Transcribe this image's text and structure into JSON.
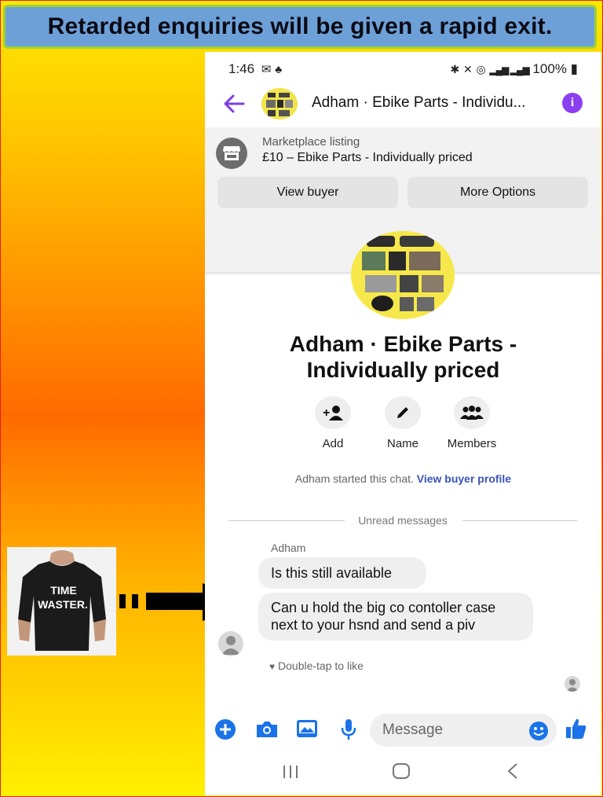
{
  "banner": {
    "text": "Retarded enquiries will be given a rapid exit."
  },
  "status": {
    "time": "1:46",
    "battery": "100%",
    "left_icons": "gmail-icon, notification-icon",
    "right_icons": "bluetooth, mute, hotspot, 4G signal, signal"
  },
  "header": {
    "title": "Adham · Ebike Parts  - Individu...",
    "info_label": "i"
  },
  "listing": {
    "label": "Marketplace listing",
    "item": "£10 – Ebike Parts  - Individually priced",
    "view_buyer": "View buyer",
    "more_options": "More Options"
  },
  "profile": {
    "name_line1": "Adham · Ebike Parts  -",
    "name_line2": "Individually priced",
    "actions": [
      {
        "label": "Add",
        "icon": "add-person-icon"
      },
      {
        "label": "Name",
        "icon": "pencil-icon"
      },
      {
        "label": "Members",
        "icon": "members-icon"
      }
    ]
  },
  "chat": {
    "started_text": "Adham started this chat.",
    "view_profile": "View buyer profile",
    "unread_label": "Unread messages",
    "sender": "Adham",
    "messages": [
      {
        "text": "Is this still available"
      },
      {
        "text": "Can u hold the big co contoller case next to your hsnd and send a piv"
      }
    ],
    "double_tap": "Double-tap to like"
  },
  "composer": {
    "placeholder": "Message"
  },
  "meme": {
    "shirt_text_line1": "TIME",
    "shirt_text_line2": "WASTER."
  },
  "colors": {
    "accent": "#7b3fe4",
    "messenger_blue": "#1a73e8",
    "banner_bg": "#6ea0d8"
  }
}
